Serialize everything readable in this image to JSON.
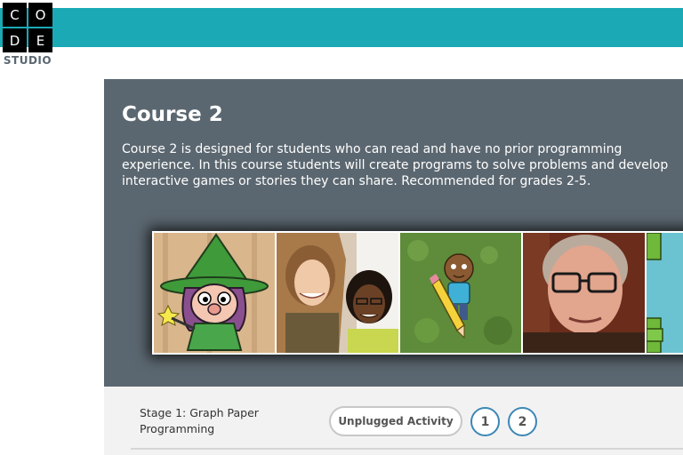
{
  "brand": {
    "letters": [
      "C",
      "O",
      "D",
      "E"
    ],
    "studio": "STUDIO",
    "bar_color": "#1ba9b6"
  },
  "course": {
    "title": "Course 2",
    "description": "Course 2 is designed for students who can read and have no prior programming experience. In this course students will create programs to solve problems and develop interactive games or stories they can share. Recommended for grades 2-5.",
    "panel_color": "#5b6770"
  },
  "thumbnails": [
    {
      "icon": "cartoon-witch-character"
    },
    {
      "icon": "two-students-photo"
    },
    {
      "icon": "cartoon-pencil-character"
    },
    {
      "icon": "man-with-glasses-photo"
    },
    {
      "icon": "flappy-game-scene"
    }
  ],
  "stages": [
    {
      "label": "Stage 1: Graph Paper Programming",
      "activity_label": "Unplugged Activity",
      "levels": [
        "1",
        "2"
      ]
    }
  ],
  "colors": {
    "level_ring": "#3c87b6"
  }
}
